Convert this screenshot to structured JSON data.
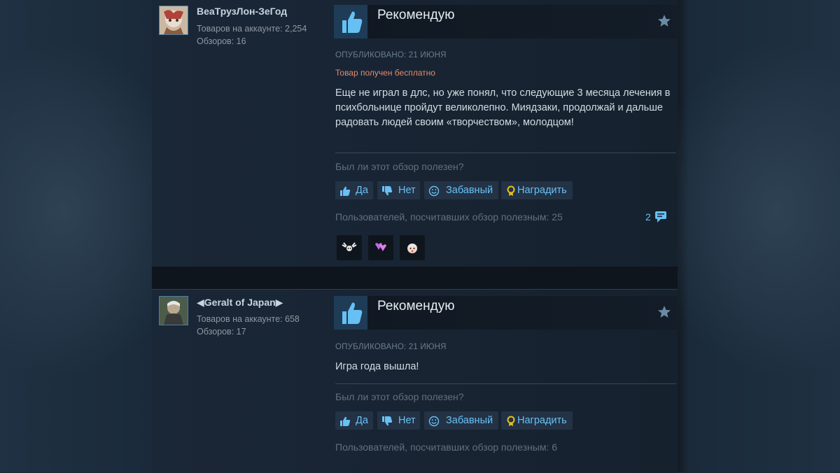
{
  "reviews": [
    {
      "author": "BeaТрузЛон-ЗеГод",
      "products_label": "Товаров на аккаунте: 2,254",
      "reviews_label": "Обзоров: 16",
      "recommendation": "Рекомендую",
      "posted": "ОПУБЛИКОВАНО: 21 ИЮНЯ",
      "free_notice": "Товар получен бесплатно",
      "text": "Еще не играл в длс, но уже понял, что следующие 3 месяца лечения в психбольнице пройдут великолепно. Миядзаки, продолжай и дальше радовать людей своим «творчеством», молодцом!",
      "helpful_question": "Был ли этот обзор полезен?",
      "buttons": {
        "yes": "Да",
        "no": "Нет",
        "funny": "Забавный",
        "award": "Наградить"
      },
      "helpful_count": "Пользователей, посчитавших обзор полезным: 25",
      "comment_count": "2",
      "awards": [
        "deer-award-icon",
        "hearts-award-icon",
        "baby-award-icon"
      ]
    },
    {
      "author": "◀Geralt of Japan▶",
      "products_label": "Товаров на аккаунте: 658",
      "reviews_label": "Обзоров: 17",
      "recommendation": "Рекомендую",
      "posted": "ОПУБЛИКОВАНО: 21 ИЮНЯ",
      "text": "Игра года вышла!",
      "helpful_question": "Был ли этот обзор полезен?",
      "buttons": {
        "yes": "Да",
        "no": "Нет",
        "funny": "Забавный",
        "award": "Наградить"
      },
      "helpful_count": "Пользователей, посчитавших обзор полезным: 6"
    }
  ],
  "colors": {
    "accent": "#67c1f5",
    "free_notice": "#e6896b",
    "background": "#1b2838"
  }
}
